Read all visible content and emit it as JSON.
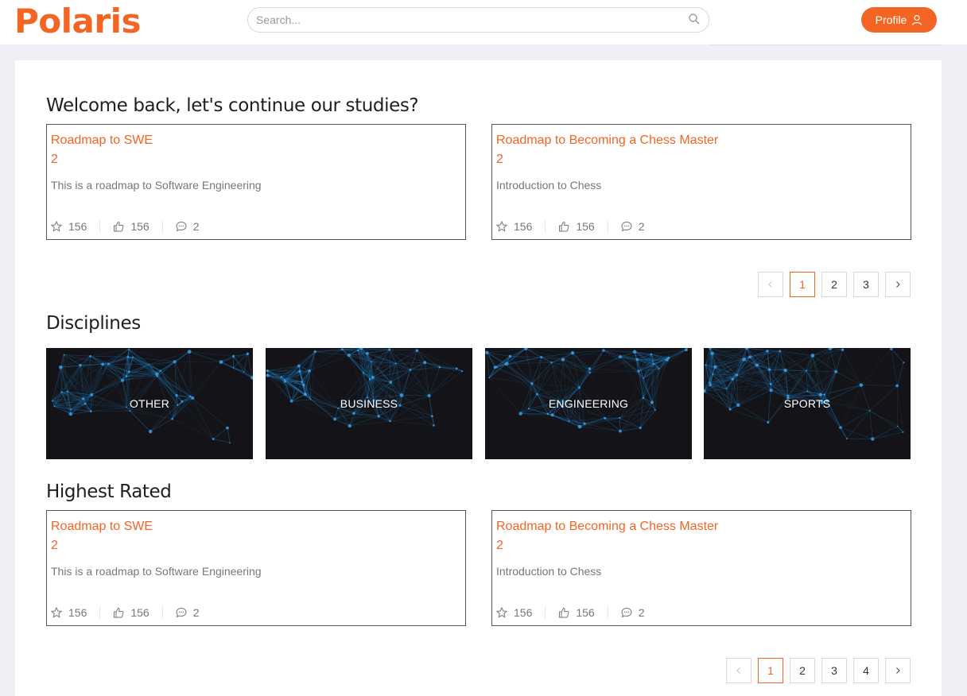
{
  "brand": {
    "name": "Polaris",
    "accent": "#f26522"
  },
  "search": {
    "placeholder": "Search...",
    "icon": "search-icon"
  },
  "profile": {
    "label": "Profile",
    "icon": "user-icon"
  },
  "welcome": {
    "title": "Welcome back, let's continue our studies?",
    "cards": [
      {
        "title": "Roadmap to SWE",
        "subtitle": "2",
        "description": "This is a roadmap to Software Engineering",
        "stars": "156",
        "likes": "156",
        "comments": "2"
      },
      {
        "title": "Roadmap to Becoming a Chess Master",
        "subtitle": "2",
        "description": "Introduction to Chess",
        "stars": "156",
        "likes": "156",
        "comments": "2"
      }
    ],
    "pages": [
      "1",
      "2",
      "3"
    ],
    "current_page": "1"
  },
  "disciplines": {
    "title": "Disciplines",
    "items": [
      "OTHER",
      "BUSINESS",
      "ENGINEERING",
      "SPORTS"
    ]
  },
  "highest_rated": {
    "title": "Highest Rated",
    "cards": [
      {
        "title": "Roadmap to SWE",
        "subtitle": "2",
        "description": "This is a roadmap to Software Engineering",
        "stars": "156",
        "likes": "156",
        "comments": "2"
      },
      {
        "title": "Roadmap to Becoming a Chess Master",
        "subtitle": "2",
        "description": "Introduction to Chess",
        "stars": "156",
        "likes": "156",
        "comments": "2"
      }
    ],
    "pages": [
      "1",
      "2",
      "3",
      "4"
    ],
    "current_page": "1"
  }
}
